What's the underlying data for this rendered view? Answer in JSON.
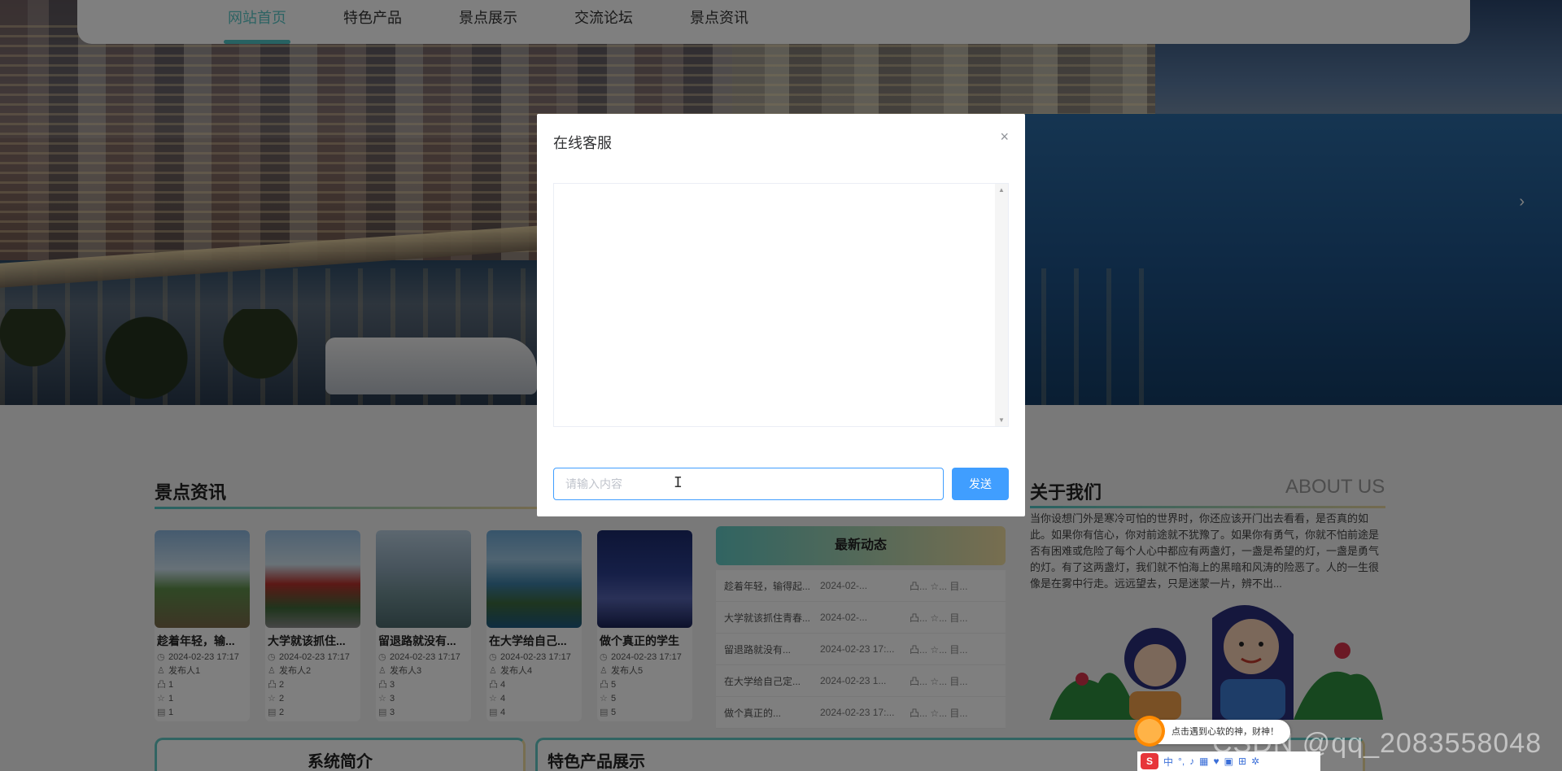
{
  "nav": {
    "items": [
      "网站首页",
      "特色产品",
      "景点展示",
      "交流论坛",
      "景点资讯"
    ]
  },
  "news": {
    "title": "景点资讯",
    "cards": [
      {
        "title": "趁着年轻，输...",
        "date": "2024-02-23 17:17",
        "author": "发布人1",
        "likes": "1",
        "favs": "1",
        "comments": "1"
      },
      {
        "title": "大学就该抓住...",
        "date": "2024-02-23 17:17",
        "author": "发布人2",
        "likes": "2",
        "favs": "2",
        "comments": "2"
      },
      {
        "title": "留退路就没有...",
        "date": "2024-02-23 17:17",
        "author": "发布人3",
        "likes": "3",
        "favs": "3",
        "comments": "3"
      },
      {
        "title": "在大学给自己...",
        "date": "2024-02-23 17:17",
        "author": "发布人4",
        "likes": "4",
        "favs": "4",
        "comments": "4"
      },
      {
        "title": "做个真正的学生",
        "date": "2024-02-23 17:17",
        "author": "发布人5",
        "likes": "5",
        "favs": "5",
        "comments": "5"
      }
    ]
  },
  "latest": {
    "title": "最新动态",
    "rows": [
      {
        "title": "趁着年轻，输得起...",
        "date": "2024-02-...",
        "extra": "凸... ☆... 目..."
      },
      {
        "title": "大学就该抓住青春...",
        "date": "2024-02-...",
        "extra": "凸... ☆... 目..."
      },
      {
        "title": "留退路就没有...",
        "date": "2024-02-23 17:...",
        "extra": "凸... ☆... 目..."
      },
      {
        "title": "在大学给自己定...",
        "date": "2024-02-23 1...",
        "extra": "凸... ☆... 目..."
      },
      {
        "title": "做个真正的...",
        "date": "2024-02-23 17:...",
        "extra": "凸... ☆... 目..."
      }
    ]
  },
  "about": {
    "title": "关于我们",
    "title_en": "ABOUT US",
    "body": "当你设想门外是寒冷可怕的世界时，你还应该开门出去看看，是否真的如此。如果你有信心，你对前途就不犹豫了。如果你有勇气，你就不怕前途是否有困难或危险了每个人心中都应有两盏灯，一盏是希望的灯，一盏是勇气的灯。有了这两盏灯，我们就不怕海上的黑暗和风涛的险恶了。人的一生很像是在雾中行走。远远望去，只是迷蒙一片，辨不出..."
  },
  "bottom": {
    "intro": "系统简介",
    "products": "特色产品展示"
  },
  "modal": {
    "title": "在线客服",
    "close": "×",
    "input_placeholder": "请输入内容",
    "send_label": "发送"
  },
  "ime": {
    "tip": "点击遇到心软的神，财神！",
    "lang": "中",
    "logo": "S"
  },
  "watermark": "CSDN @qq_2083558048",
  "colors": {
    "accent": "#4fc4c4",
    "primary": "#409eff",
    "gold": "#efdca0"
  }
}
